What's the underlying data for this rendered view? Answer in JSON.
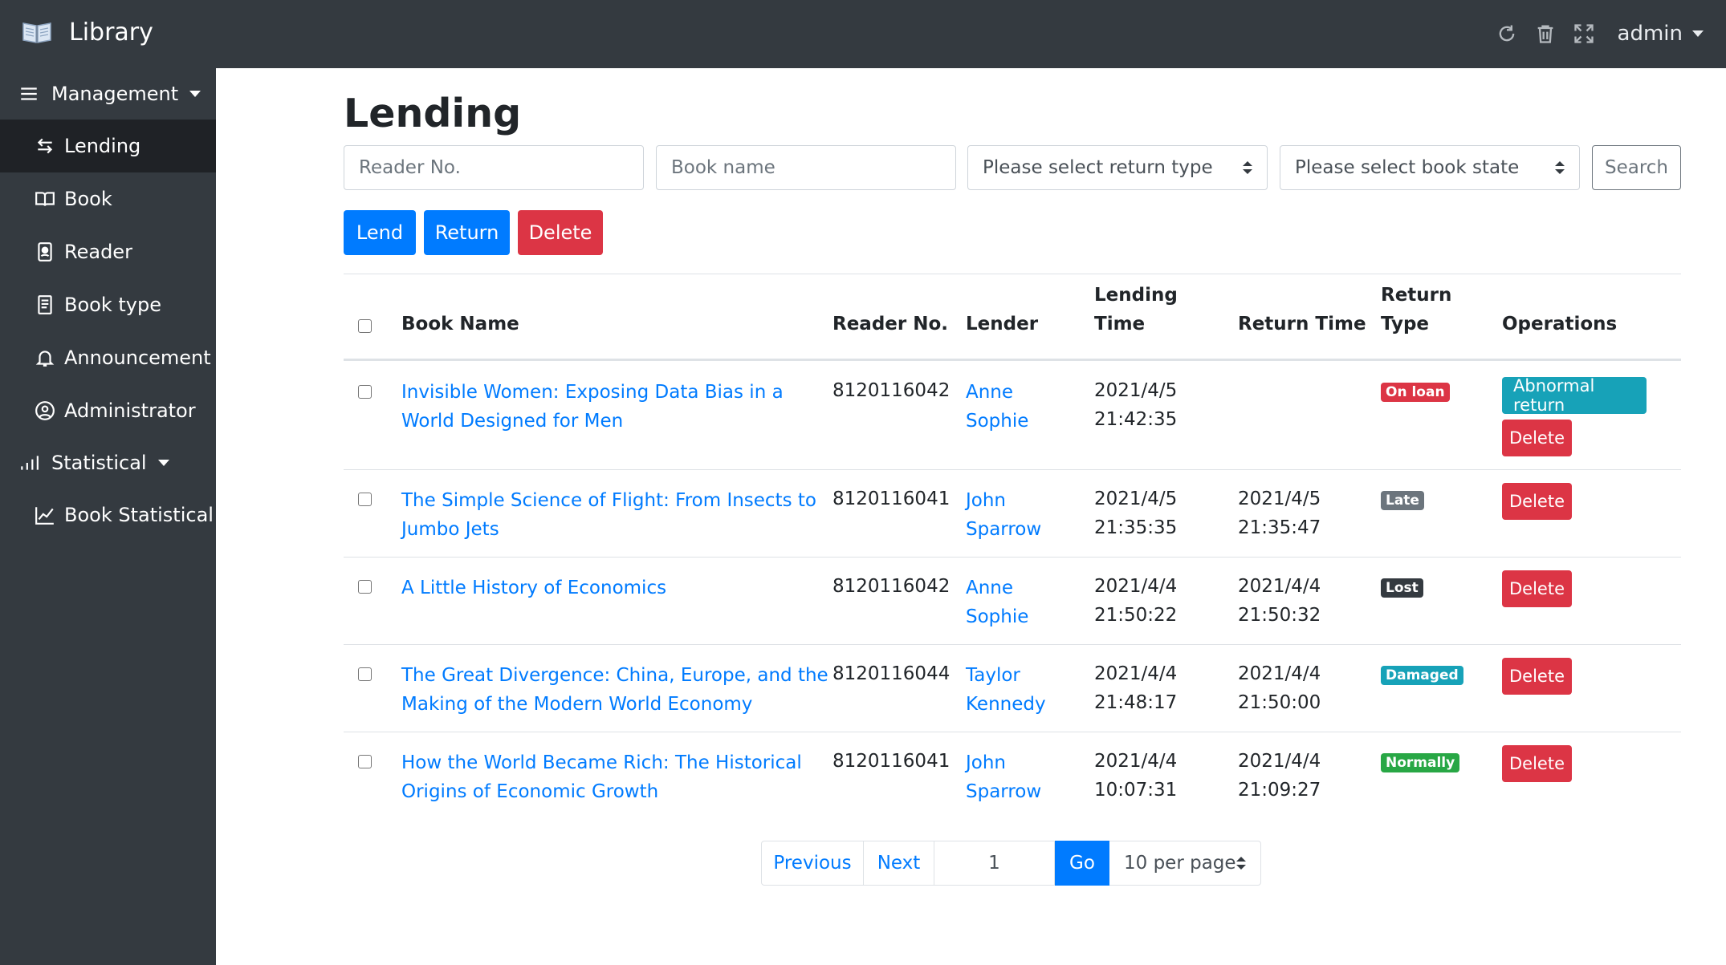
{
  "app": {
    "title": "Library"
  },
  "topbar": {
    "user": "admin",
    "icons": [
      "refresh-icon",
      "trash-icon",
      "fullscreen-icon"
    ]
  },
  "sidebar": {
    "management_label": "Management",
    "items": [
      {
        "label": "Lending",
        "icon": "exchange-icon",
        "active": true
      },
      {
        "label": "Book",
        "icon": "book-icon"
      },
      {
        "label": "Reader",
        "icon": "reader-card-icon"
      },
      {
        "label": "Book type",
        "icon": "document-icon"
      },
      {
        "label": "Announcement",
        "icon": "bell-icon"
      },
      {
        "label": "Administrator",
        "icon": "user-circle-icon"
      }
    ],
    "statistical_label": "Statistical",
    "stat_items": [
      {
        "label": "Book Statistical",
        "icon": "line-chart-icon"
      }
    ]
  },
  "page": {
    "title": "Lending"
  },
  "filters": {
    "reader_placeholder": "Reader No.",
    "book_placeholder": "Book name",
    "return_type_placeholder": "Please select return type",
    "book_state_placeholder": "Please select book state",
    "search_label": "Search"
  },
  "actions": {
    "lend": "Lend",
    "return": "Return",
    "delete": "Delete"
  },
  "table": {
    "headers": {
      "book_name": "Book Name",
      "reader_no": "Reader No.",
      "lender": "Lender",
      "lending_time_1": "Lending",
      "lending_time_2": "Time",
      "return_time": "Return Time",
      "return_type_1": "Return",
      "return_type_2": "Type",
      "operations": "Operations"
    },
    "rows": [
      {
        "book_l1": "Invisible Women: Exposing Data Bias in a",
        "book_l2": "World Designed for Men",
        "reader": "8120116042",
        "lender_l1": "Anne",
        "lender_l2": "Sophie",
        "lend_date": "2021/4/5",
        "lend_time": "21:42:35",
        "return_date": "",
        "return_time": "",
        "status": "On loan",
        "op_abnormal": "Abnormal return",
        "op_delete": "Delete"
      },
      {
        "book_l1": "The Simple Science of Flight: From Insects to",
        "book_l2": "Jumbo Jets",
        "reader": "8120116041",
        "lender_l1": "John",
        "lender_l2": "Sparrow",
        "lend_date": "2021/4/5",
        "lend_time": "21:35:35",
        "return_date": "2021/4/5",
        "return_time": "21:35:47",
        "status": "Late",
        "op_delete": "Delete"
      },
      {
        "book_l1": "A Little History of Economics",
        "book_l2": "",
        "reader": "8120116042",
        "lender_l1": "Anne",
        "lender_l2": "Sophie",
        "lend_date": "2021/4/4",
        "lend_time": "21:50:22",
        "return_date": "2021/4/4",
        "return_time": "21:50:32",
        "status": "Lost",
        "op_delete": "Delete"
      },
      {
        "book_l1": "The Great Divergence: China, Europe, and the",
        "book_l2": "Making of the Modern World Economy",
        "reader": "8120116044",
        "lender_l1": "Taylor",
        "lender_l2": "Kennedy",
        "lend_date": "2021/4/4",
        "lend_time": "21:48:17",
        "return_date": "2021/4/4",
        "return_time": "21:50:00",
        "status": "Damaged",
        "op_delete": "Delete"
      },
      {
        "book_l1": "How the World Became Rich: The Historical",
        "book_l2": "Origins of Economic Growth",
        "reader": "8120116041",
        "lender_l1": "John",
        "lender_l2": "Sparrow",
        "lend_date": "2021/4/4",
        "lend_time": "10:07:31",
        "return_date": "2021/4/4",
        "return_time": "21:09:27",
        "status": "Normally",
        "op_delete": "Delete"
      }
    ]
  },
  "pagination": {
    "previous": "Previous",
    "next": "Next",
    "page": "1",
    "go": "Go",
    "page_size": "10 per page"
  },
  "colors": {
    "primary": "#007bff",
    "danger": "#dc3545",
    "info": "#17a2b8",
    "success": "#28a745",
    "secondary": "#6c757d",
    "dark": "#343a40"
  }
}
